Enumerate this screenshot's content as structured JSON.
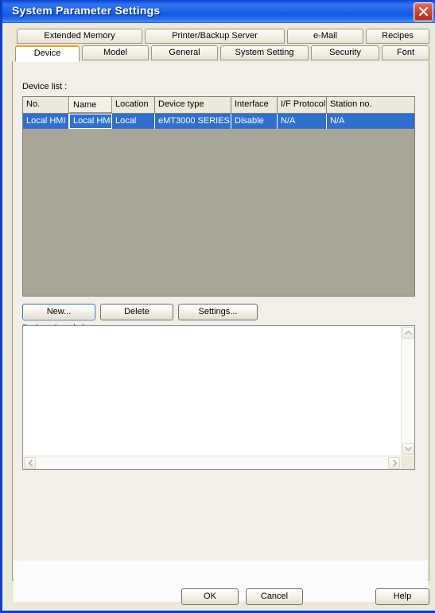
{
  "window": {
    "title": "System Parameter Settings",
    "close_icon": "close-icon",
    "accent_titlebar": "#1f63e8",
    "close_button_color": "#c63524",
    "dialog_bg": "#ece9d8"
  },
  "tabs": {
    "row1": [
      {
        "label": "Extended Memory",
        "active": false
      },
      {
        "label": "Printer/Backup Server",
        "active": false
      },
      {
        "label": "e-Mail",
        "active": false
      },
      {
        "label": "Recipes",
        "active": false
      }
    ],
    "row2": [
      {
        "label": "Device",
        "active": true
      },
      {
        "label": "Model",
        "active": false
      },
      {
        "label": "General",
        "active": false
      },
      {
        "label": "System Setting",
        "active": false
      },
      {
        "label": "Security",
        "active": false
      },
      {
        "label": "Font",
        "active": false
      }
    ],
    "active_tab": "Device",
    "active_tab_accent": "#f0a030"
  },
  "device_panel": {
    "list_label": "Device list :",
    "list_bg_color": "#a9a697",
    "selection_color": "#2f6fce",
    "columns": [
      {
        "label": "No."
      },
      {
        "label": "Name"
      },
      {
        "label": "Location"
      },
      {
        "label": "Device type"
      },
      {
        "label": "Interface"
      },
      {
        "label": "I/F Protocol"
      },
      {
        "label": "Station no."
      }
    ],
    "rows": [
      {
        "no": "Local HMI",
        "name": "Local HMI",
        "location": "Local",
        "device_type": "eMT3000 SERIES",
        "interface": "Disable",
        "if_protocol": "N/A",
        "station_no": "N/A",
        "selected": true
      }
    ],
    "buttons": {
      "new": "New...",
      "delete": "Delete",
      "settings": "Settings..."
    }
  },
  "project_description": {
    "label": "Project description :",
    "value": "",
    "placeholder": "",
    "scroll_up_icon": "chevron-up-icon",
    "scroll_down_icon": "chevron-down-icon",
    "scroll_left_icon": "chevron-left-icon",
    "scroll_right_icon": "chevron-right-icon"
  },
  "footer": {
    "ok": "OK",
    "cancel": "Cancel",
    "help": "Help"
  }
}
